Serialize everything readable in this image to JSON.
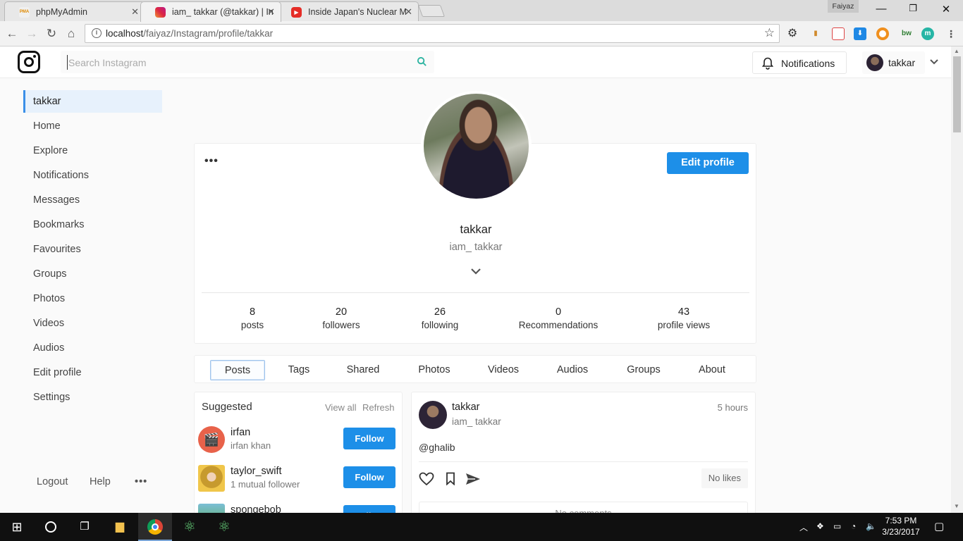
{
  "browser": {
    "tabs": [
      {
        "title": "phpMyAdmin",
        "favicon": "phpmyadmin-icon",
        "favicon_label": "PMA",
        "active": false
      },
      {
        "title": "iam_ takkar (@takkar) | In",
        "favicon": "instagram-icon",
        "active": true
      },
      {
        "title": "Inside Japan's Nuclear M",
        "favicon": "youtube-icon",
        "active": false
      }
    ],
    "window_user": "Faiyaz",
    "url_host": "localhost",
    "url_path": "/faiyaz/Instagram/profile/takkar",
    "extension_labels": {
      "bw": "bw",
      "m": "m"
    }
  },
  "header": {
    "search_placeholder": "Search Instagram",
    "notifications_label": "Notifications",
    "user_label": "takkar"
  },
  "sidebar": {
    "items": [
      {
        "label": "takkar",
        "active": true
      },
      {
        "label": "Home"
      },
      {
        "label": "Explore"
      },
      {
        "label": "Notifications"
      },
      {
        "label": "Messages"
      },
      {
        "label": "Bookmarks"
      },
      {
        "label": "Favourites"
      },
      {
        "label": "Groups"
      },
      {
        "label": "Photos"
      },
      {
        "label": "Videos"
      },
      {
        "label": "Audios"
      },
      {
        "label": "Edit profile"
      },
      {
        "label": "Settings"
      }
    ],
    "footer": {
      "logout": "Logout",
      "help": "Help",
      "more": "•••"
    }
  },
  "profile": {
    "menu": "•••",
    "edit_button": "Edit profile",
    "name": "takkar",
    "handle": "iam_ takkar",
    "stats": [
      {
        "value": "8",
        "label": "posts"
      },
      {
        "value": "20",
        "label": "followers"
      },
      {
        "value": "26",
        "label": "following"
      },
      {
        "value": "0",
        "label": "Recommendations"
      },
      {
        "value": "43",
        "label": "profile views"
      }
    ]
  },
  "tabs": [
    "Posts",
    "Tags",
    "Shared",
    "Photos",
    "Videos",
    "Audios",
    "Groups",
    "About"
  ],
  "active_tab": "Posts",
  "suggested": {
    "title": "Suggested",
    "view_all": "View all",
    "refresh": "Refresh",
    "users": [
      {
        "name": "irfan",
        "sub": "irfan khan",
        "follow": "Follow",
        "avatar_color": "#e8624a"
      },
      {
        "name": "taylor_swift",
        "sub": "1 mutual follower",
        "follow": "Follow",
        "avatar_color": "#e3b34a"
      },
      {
        "name": "spongebob",
        "sub": "",
        "follow": "Follow",
        "avatar_color": "#6fb3c9"
      }
    ]
  },
  "post": {
    "author": "takkar",
    "handle": "iam_ takkar",
    "time": "5 hours",
    "body": "@ghalib",
    "likes": "No likes",
    "comments": "No comments"
  },
  "taskbar": {
    "time": "7:53 PM",
    "date": "3/23/2017"
  },
  "colors": {
    "accent": "#1d8fe8",
    "active_bg": "#e7f1fc",
    "active_border": "#3a8fe8"
  }
}
